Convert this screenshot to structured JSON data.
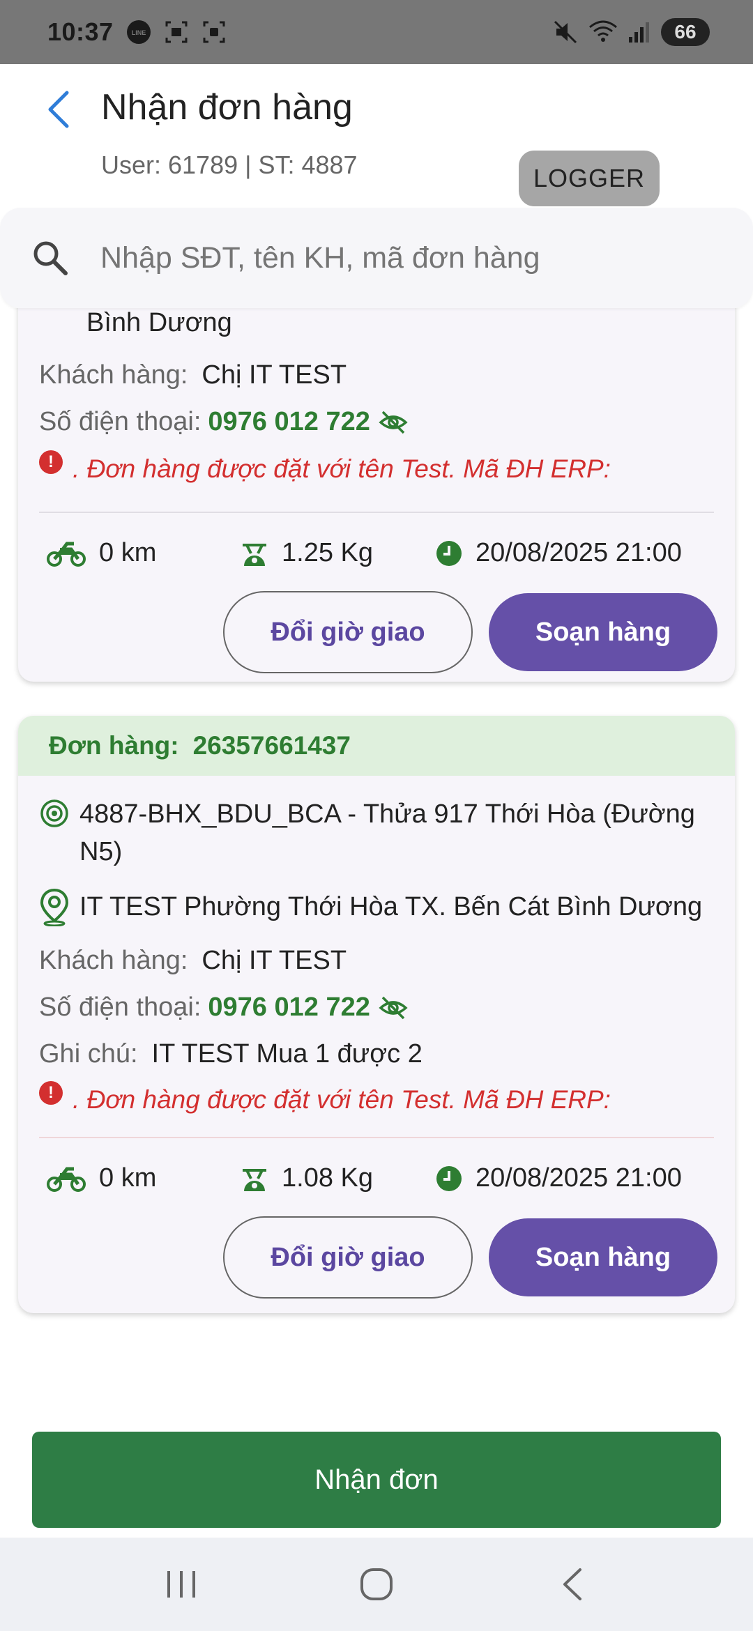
{
  "status_bar": {
    "time": "10:37",
    "battery": "66"
  },
  "header": {
    "title": "Nhận đơn hàng",
    "subtitle": "User: 61789 | ST: 4887",
    "logger_label": "LOGGER"
  },
  "search": {
    "placeholder": "Nhập SĐT, tên KH, mã đơn hàng"
  },
  "orders": [
    {
      "address_tail": "Bình Dương",
      "customer_label": "Khách hàng:",
      "customer": "Chị IT TEST",
      "phone_label": "Số điện thoại:",
      "phone": "0976 012 722",
      "warning": ". Đơn hàng được đặt với tên Test. Mã ĐH ERP:",
      "distance": "0 km",
      "weight": "1.25 Kg",
      "time": "20/08/2025 21:00",
      "change_time_label": "Đổi giờ giao",
      "prepare_label": "Soạn hàng"
    },
    {
      "order_label": "Đơn hàng:",
      "order_id": "26357661437",
      "store_address_line1": "4887-BHX_BDU_BCA - Thửa 917 Thới Hòa (Đường",
      "store_address_line2": "N5)",
      "customer_address": "IT TEST Phường Thới Hòa TX. Bến Cát Bình Dương",
      "customer_label": "Khách hàng:",
      "customer": "Chị IT TEST",
      "phone_label": "Số điện thoại:",
      "phone": "0976 012 722",
      "note_label": "Ghi chú:",
      "note": "IT TEST Mua 1 được 2",
      "warning": ". Đơn hàng được đặt với tên Test. Mã ĐH ERP:",
      "distance": "0 km",
      "weight": "1.08 Kg",
      "time": "20/08/2025 21:00",
      "change_time_label": "Đổi giờ giao",
      "prepare_label": "Soạn hàng"
    }
  ],
  "footer": {
    "accept_label": "Nhận đơn"
  },
  "colors": {
    "accent_green": "#2e7d32",
    "button_purple": "#6550a8",
    "warning_red": "#d32f2f"
  }
}
